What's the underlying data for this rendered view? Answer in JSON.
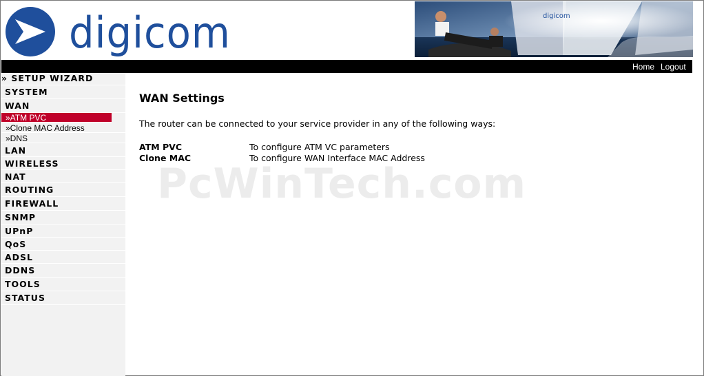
{
  "brand": {
    "name": "digicom",
    "color": "#1f4f9c",
    "banner_logo": "digicom"
  },
  "topbar": {
    "home": "Home",
    "logout": "Logout"
  },
  "sidebar": {
    "setup_wizard": "» SETUP WIZARD",
    "items": [
      {
        "label": "SYSTEM"
      },
      {
        "label": "WAN"
      },
      {
        "label": "LAN"
      },
      {
        "label": "WIRELESS"
      },
      {
        "label": "NAT"
      },
      {
        "label": "ROUTING"
      },
      {
        "label": "FIREWALL"
      },
      {
        "label": "SNMP"
      },
      {
        "label": "UPnP"
      },
      {
        "label": "QoS"
      },
      {
        "label": "ADSL"
      },
      {
        "label": "DDNS"
      },
      {
        "label": "TOOLS"
      },
      {
        "label": "STATUS"
      }
    ],
    "wan_sub": [
      {
        "label": "»ATM PVC",
        "active": true
      },
      {
        "label": "»Clone MAC Address",
        "active": false
      },
      {
        "label": "»DNS",
        "active": false
      }
    ],
    "active_color": "#c0002a"
  },
  "main": {
    "title": "WAN Settings",
    "intro": "The router can be connected to your service provider in any of the following ways:",
    "rows": [
      {
        "label": "ATM PVC",
        "desc": "To configure ATM VC parameters"
      },
      {
        "label": "Clone MAC",
        "desc": "To configure WAN Interface MAC Address"
      }
    ]
  },
  "watermark": "PcWinTech.com"
}
